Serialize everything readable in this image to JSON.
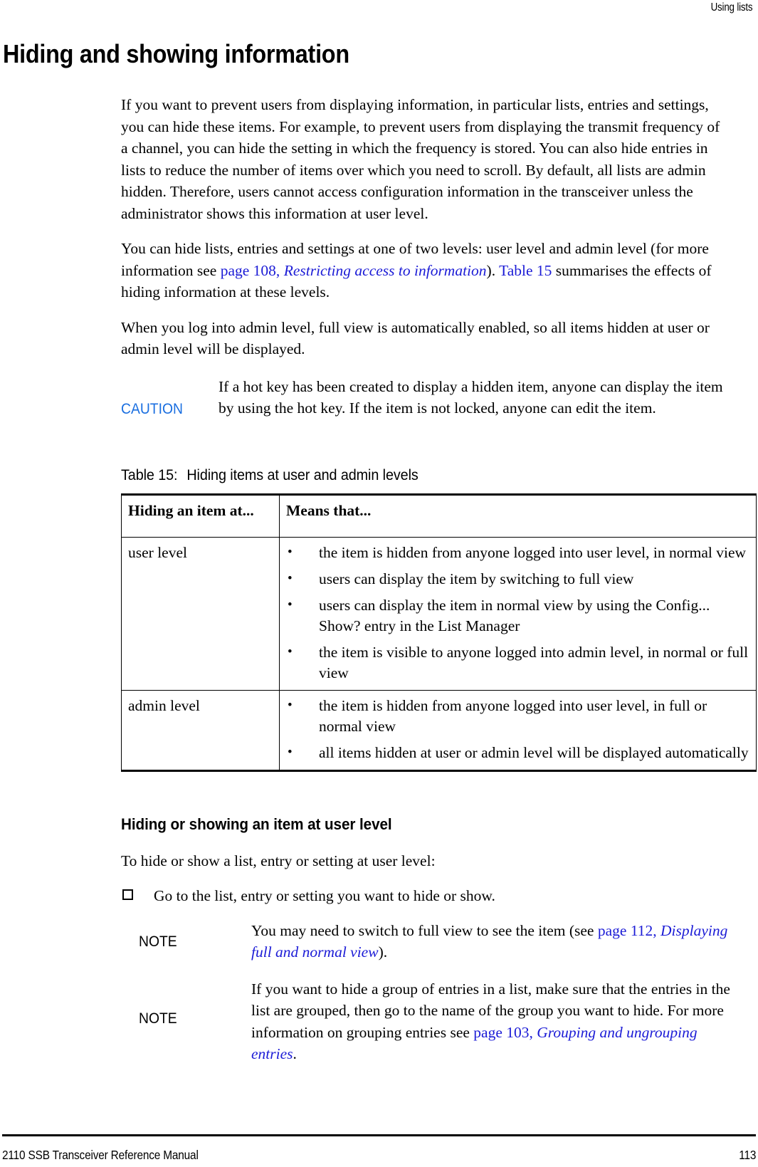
{
  "header": {
    "running_head": "Using lists"
  },
  "title": "Hiding and showing information",
  "paragraphs": {
    "p1": "If you want to prevent users from displaying information, in particular lists, entries and settings, you can hide these items. For example, to prevent users from displaying the transmit frequency of a channel, you can hide the setting in which the frequency is stored. You can also hide entries in lists to reduce the number of items over which you need to scroll. By default, all lists are admin hidden. Therefore, users cannot access configuration information in the transceiver unless the administrator shows this information at user level.",
    "p2_part1": "You can hide lists, entries and settings at one of two levels: user level and admin level (for more information see ",
    "p2_link1": "page 108, ",
    "p2_link1_italic": "Restricting access to information",
    "p2_part2": "). ",
    "p2_link2": "Table 15",
    "p2_part3": " summarises the effects of hiding information at these levels.",
    "p3": "When you log into admin level, full view is automatically enabled, so all items hidden at user or admin level will be displayed."
  },
  "caution": {
    "label": "CAUTION",
    "text": "If a hot key has been created to display a hidden item, anyone can display the item by using the hot key. If the item is not locked, anyone can edit the item."
  },
  "table": {
    "caption_number": "Table 15:",
    "caption_text": "Hiding items at user and admin levels",
    "headers": [
      "Hiding an item at...",
      "Means that..."
    ],
    "rows": [
      {
        "level": "user level",
        "bullets": [
          "the item is hidden from anyone logged into user level, in normal view",
          "users can display the item by switching to full view",
          "users can display the item in normal view by using the Config... Show? entry in the List Manager",
          "the item is visible to anyone logged into admin level, in normal or full view"
        ]
      },
      {
        "level": "admin level",
        "bullets": [
          "the item is hidden from anyone logged into user level, in full or normal view",
          "all items hidden at user or admin level will be displayed automatically"
        ]
      }
    ]
  },
  "section": {
    "heading": "Hiding or showing an item at user level",
    "intro": "To hide or show a list, entry or setting at user level:",
    "step1": "Go to the list, entry or setting you want to hide or show."
  },
  "notes": [
    {
      "label": "NOTE",
      "text_part1": "You may need to switch to full view to see the item (see ",
      "link": "page 112,",
      "link_italic": " Displaying full and normal view",
      "text_part2": ")."
    },
    {
      "label": "NOTE",
      "text_part1": "If you want to hide a group of entries in a list, make sure that the entries in the list are grouped, then go to the name of the group you want to hide. For more information on grouping entries see ",
      "link": "page 103,",
      "link_italic": " Grouping and ungrouping entries",
      "text_part2": "."
    }
  ],
  "footer": {
    "manual_title": "2110 SSB Transceiver Reference Manual",
    "page_number": "113"
  },
  "colors": {
    "link_blue": "#1b1bd6",
    "caution_blue": "#1b6fe0",
    "text_black": "#000000"
  }
}
